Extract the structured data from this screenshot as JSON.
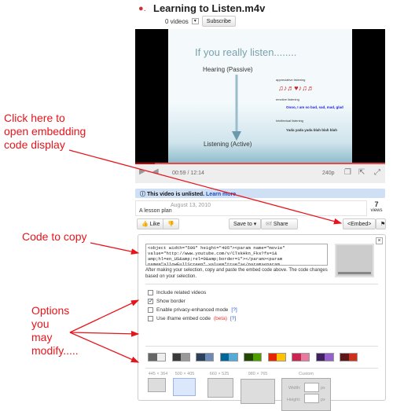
{
  "header": {
    "title": "Learning to Listen.m4v",
    "videos": "0 videos",
    "subscribe": "Subscribe"
  },
  "slide": {
    "heading": "If you really listen........",
    "hearing": "Hearing (Passive)",
    "listening": "Listening (Active)",
    "appreciative": "appreciative listening",
    "emotive": "emotive listening",
    "emotive_text": "Oooo, I am so bad, sad, mad, glad",
    "intellectual": "Intellectual listening",
    "intellectual_text": "Yada yada yada blah blah blah"
  },
  "player": {
    "time": "00:59 / 12:14",
    "quality": "240p",
    "progress_percent": 8
  },
  "notice": {
    "text": "This video is unlisted.",
    "link": "Learn more"
  },
  "info": {
    "date": "August 13, 2010",
    "description": "A lesson plan",
    "views_count": "7",
    "views_label": "views"
  },
  "actions": {
    "like": "Like",
    "save_to": "Save to",
    "share": "Share",
    "embed": "<Embed>"
  },
  "embed": {
    "code": "<object width=\"500\" height=\"405\"><param name=\"movie\"\nvalue=\"http://www.youtube.com/v/CTskHkn_Fks?fs=1&\namp;hl=en_US&amp;rel=0&amp;border=1\"></param><param\nname=\"allowFullScreen\" value=\"true\"></param><param",
    "help": "After making your selection, copy and paste the embed code above. The code changes based on your selection.",
    "options": [
      {
        "label": "Include related videos",
        "checked": false
      },
      {
        "label": "Show border",
        "checked": true
      },
      {
        "label": "Enable privacy-enhanced mode",
        "help": "[?]",
        "checked": false
      },
      {
        "label": "Use iframe embed code",
        "beta": "(beta)",
        "help": "[?]",
        "checked": false
      }
    ],
    "colors": [
      [
        "#666666",
        "#eeeeee"
      ],
      [
        "#3a3a3a",
        "#999999"
      ],
      [
        "#2b405b",
        "#6b8ab6"
      ],
      [
        "#006699",
        "#54abd6"
      ],
      [
        "#234900",
        "#4e9e00"
      ],
      [
        "#e62600",
        "#ffc200"
      ],
      [
        "#cc2550",
        "#e87a9f"
      ],
      [
        "#402061",
        "#9461ca"
      ],
      [
        "#5d1719",
        "#cd311b"
      ]
    ],
    "sizes": [
      "445 × 364",
      "500 × 405",
      "660 × 525",
      "980 × 765"
    ],
    "selected_size": "500 × 405",
    "custom": "Custom",
    "width_label": "Width:",
    "height_label": "Height:",
    "px": "px"
  },
  "annotations": {
    "click": [
      "Click here to",
      "open embedding",
      "code display"
    ],
    "code": "Code to copy",
    "options": [
      "Options",
      "you",
      "may",
      "modify....."
    ]
  },
  "accent": "#e8141b"
}
